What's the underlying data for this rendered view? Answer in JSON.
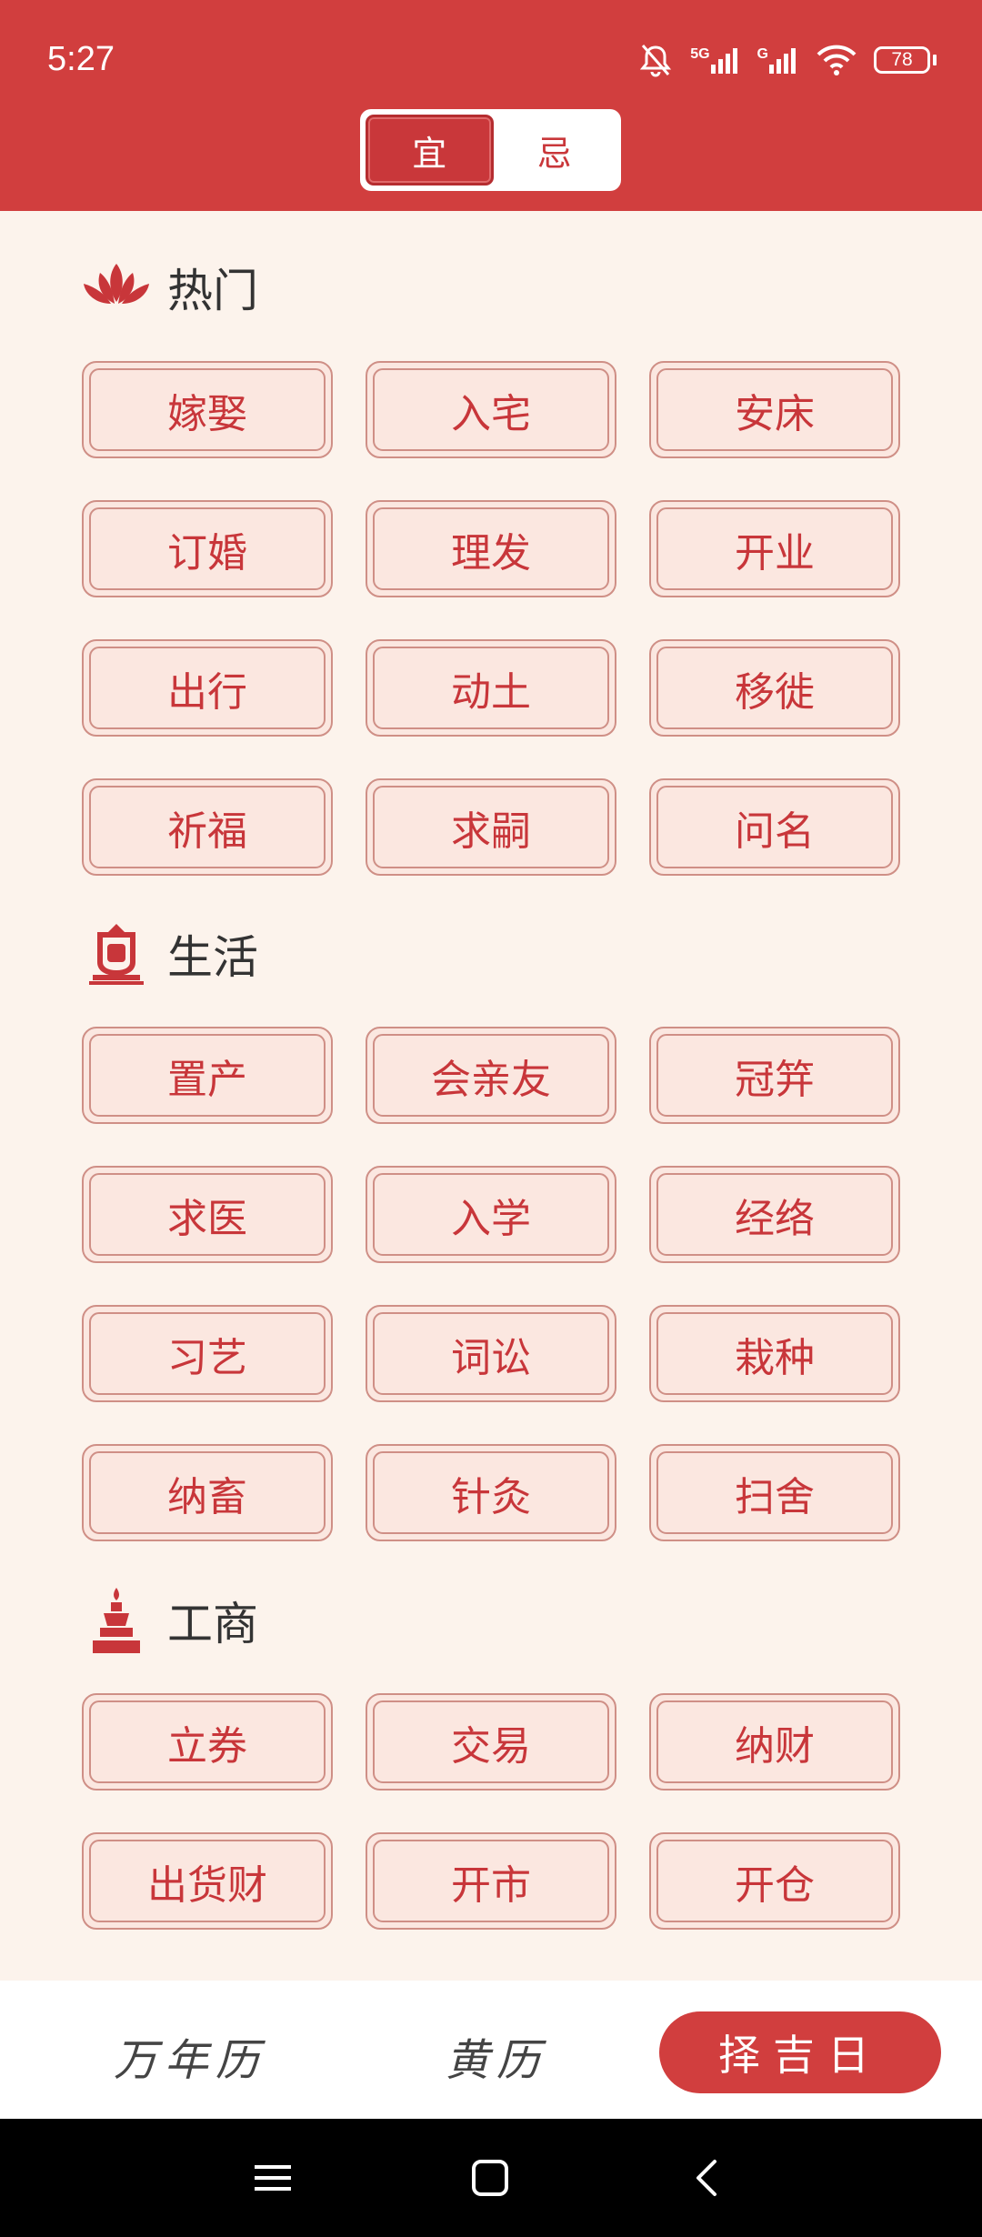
{
  "status": {
    "time": "5:27",
    "battery": "78",
    "signal1": "5G",
    "signal2": "G"
  },
  "tabs": {
    "yi": "宜",
    "ji": "忌"
  },
  "sections": [
    {
      "title": "热门",
      "icon": "lotus-icon",
      "items": [
        "嫁娶",
        "入宅",
        "安床",
        "订婚",
        "理发",
        "开业",
        "出行",
        "动土",
        "移徙",
        "祈福",
        "求嗣",
        "问名"
      ]
    },
    {
      "title": "生活",
      "icon": "bell-shrine-icon",
      "items": [
        "置产",
        "会亲友",
        "冠笄",
        "求医",
        "入学",
        "经络",
        "习艺",
        "词讼",
        "栽种",
        "纳畜",
        "针灸",
        "扫舍"
      ]
    },
    {
      "title": "工商",
      "icon": "pagoda-icon",
      "items": [
        "立券",
        "交易",
        "纳财",
        "出货财",
        "开市",
        "开仓"
      ]
    }
  ],
  "nav": {
    "calendar": "万年历",
    "almanac": "黄历",
    "auspicious": "择吉日"
  },
  "colors": {
    "primary": "#d13e3e",
    "background": "#fcf3ec",
    "tag_bg": "#fbe7e0",
    "tag_border": "#cf8f86"
  }
}
